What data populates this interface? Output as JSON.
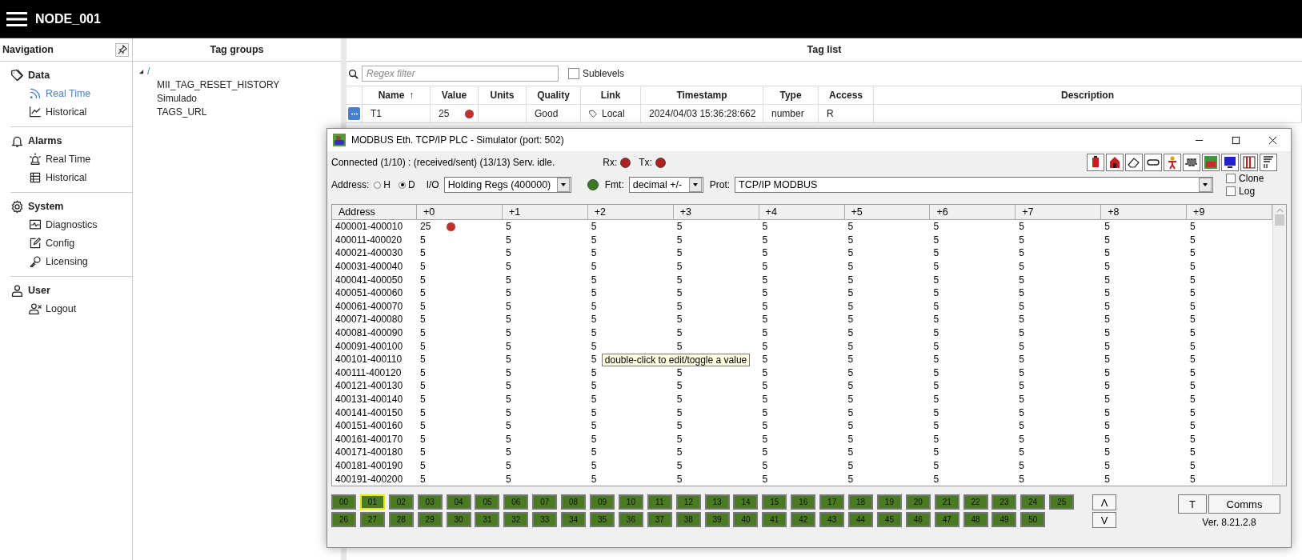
{
  "header": {
    "title": "NODE_001"
  },
  "navigation": {
    "title": "Navigation",
    "sections": [
      {
        "label": "Data",
        "items": [
          {
            "label": "Real Time",
            "selected": true
          },
          {
            "label": "Historical",
            "selected": false
          }
        ]
      },
      {
        "label": "Alarms",
        "items": [
          {
            "label": "Real Time",
            "selected": false
          },
          {
            "label": "Historical",
            "selected": false
          }
        ]
      },
      {
        "label": "System",
        "items": [
          {
            "label": "Diagnostics",
            "selected": false
          },
          {
            "label": "Config",
            "selected": false
          },
          {
            "label": "Licensing",
            "selected": false
          }
        ]
      },
      {
        "label": "User",
        "items": [
          {
            "label": "Logout",
            "selected": false
          }
        ]
      }
    ]
  },
  "tag_groups": {
    "title": "Tag groups",
    "tree": [
      {
        "label": "/",
        "expanded": true,
        "children": [
          {
            "label": "MII_TAG_RESET_HISTORY"
          },
          {
            "label": "Simulado"
          },
          {
            "label": "TAGS_URL"
          }
        ]
      }
    ]
  },
  "tag_list": {
    "title": "Tag list",
    "filter": {
      "placeholder": "Regex filter"
    },
    "sublevels": {
      "label": "Sublevels",
      "checked": false
    },
    "columns": [
      {
        "label": "Name",
        "sort": "↑"
      },
      {
        "label": "Value"
      },
      {
        "label": "Units"
      },
      {
        "label": "Quality"
      },
      {
        "label": "Link"
      },
      {
        "label": "Timestamp"
      },
      {
        "label": "Type"
      },
      {
        "label": "Access"
      },
      {
        "label": "Description"
      }
    ],
    "rows": [
      {
        "name": "T1",
        "value": "25",
        "marked": true,
        "quality": "Good",
        "link": "Local",
        "timestamp": "2024/04/03 15:36:28:662",
        "type": "number",
        "access": "R"
      }
    ]
  },
  "simulator": {
    "title": "MODBUS Eth. TCP/IP PLC - Simulator (port: 502)",
    "status": "Connected (1/10) : (received/sent) (13/13) Serv. idle.",
    "indicators": [
      {
        "label": "Rx:",
        "color": "#b02020"
      },
      {
        "label": "Tx:",
        "color": "#b02020"
      }
    ],
    "address": {
      "label": "Address:",
      "options": [
        {
          "label": "H",
          "selected": false
        },
        {
          "label": "D",
          "selected": true
        }
      ]
    },
    "io": {
      "label": "I/O",
      "value": "Holding Regs (400000)"
    },
    "fmt": {
      "label": "Fmt:",
      "value": "decimal +/-"
    },
    "prot": {
      "label": "Prot:",
      "value": "TCP/IP MODBUS"
    },
    "options": [
      {
        "label": "Clone",
        "checked": false
      },
      {
        "label": "Log",
        "checked": false
      }
    ],
    "grid": {
      "columns": [
        "Address",
        "+0",
        "+1",
        "+2",
        "+3",
        "+4",
        "+5",
        "+6",
        "+7",
        "+8",
        "+9"
      ],
      "rows": [
        {
          "address": "400001-400010",
          "marked": true,
          "values": [
            "25",
            "5",
            "5",
            "5",
            "5",
            "5",
            "5",
            "5",
            "5",
            "5"
          ]
        },
        {
          "address": "400011-400020",
          "marked": false,
          "values": [
            "5",
            "5",
            "5",
            "5",
            "5",
            "5",
            "5",
            "5",
            "5",
            "5"
          ]
        },
        {
          "address": "400021-400030",
          "marked": false,
          "values": [
            "5",
            "5",
            "5",
            "5",
            "5",
            "5",
            "5",
            "5",
            "5",
            "5"
          ]
        },
        {
          "address": "400031-400040",
          "marked": false,
          "values": [
            "5",
            "5",
            "5",
            "5",
            "5",
            "5",
            "5",
            "5",
            "5",
            "5"
          ]
        },
        {
          "address": "400041-400050",
          "marked": false,
          "values": [
            "5",
            "5",
            "5",
            "5",
            "5",
            "5",
            "5",
            "5",
            "5",
            "5"
          ]
        },
        {
          "address": "400051-400060",
          "marked": false,
          "values": [
            "5",
            "5",
            "5",
            "5",
            "5",
            "5",
            "5",
            "5",
            "5",
            "5"
          ]
        },
        {
          "address": "400061-400070",
          "marked": false,
          "values": [
            "5",
            "5",
            "5",
            "5",
            "5",
            "5",
            "5",
            "5",
            "5",
            "5"
          ]
        },
        {
          "address": "400071-400080",
          "marked": false,
          "values": [
            "5",
            "5",
            "5",
            "5",
            "5",
            "5",
            "5",
            "5",
            "5",
            "5"
          ]
        },
        {
          "address": "400081-400090",
          "marked": false,
          "values": [
            "5",
            "5",
            "5",
            "5",
            "5",
            "5",
            "5",
            "5",
            "5",
            "5"
          ]
        },
        {
          "address": "400091-400100",
          "marked": false,
          "values": [
            "5",
            "5",
            "5",
            "5",
            "5",
            "5",
            "5",
            "5",
            "5",
            "5"
          ]
        },
        {
          "address": "400101-400110",
          "marked": false,
          "tooltip": "double-click to edit/toggle a value",
          "values": [
            "5",
            "5",
            "5",
            "5",
            "5",
            "5",
            "5",
            "5",
            "5"
          ]
        },
        {
          "address": "400111-400120",
          "marked": false,
          "values": [
            "5",
            "5",
            "5",
            "5",
            "5",
            "5",
            "5",
            "5",
            "5",
            "5"
          ]
        },
        {
          "address": "400121-400130",
          "marked": false,
          "values": [
            "5",
            "5",
            "5",
            "5",
            "5",
            "5",
            "5",
            "5",
            "5",
            "5"
          ]
        },
        {
          "address": "400131-400140",
          "marked": false,
          "values": [
            "5",
            "5",
            "5",
            "5",
            "5",
            "5",
            "5",
            "5",
            "5",
            "5"
          ]
        },
        {
          "address": "400141-400150",
          "marked": false,
          "values": [
            "5",
            "5",
            "5",
            "5",
            "5",
            "5",
            "5",
            "5",
            "5",
            "5"
          ]
        },
        {
          "address": "400151-400160",
          "marked": false,
          "values": [
            "5",
            "5",
            "5",
            "5",
            "5",
            "5",
            "5",
            "5",
            "5",
            "5"
          ]
        },
        {
          "address": "400161-400170",
          "marked": false,
          "values": [
            "5",
            "5",
            "5",
            "5",
            "5",
            "5",
            "5",
            "5",
            "5",
            "5"
          ]
        },
        {
          "address": "400171-400180",
          "marked": false,
          "values": [
            "5",
            "5",
            "5",
            "5",
            "5",
            "5",
            "5",
            "5",
            "5",
            "5"
          ]
        },
        {
          "address": "400181-400190",
          "marked": false,
          "values": [
            "5",
            "5",
            "5",
            "5",
            "5",
            "5",
            "5",
            "5",
            "5",
            "5"
          ]
        },
        {
          "address": "400191-400200",
          "marked": false,
          "values": [
            "5",
            "5",
            "5",
            "5",
            "5",
            "5",
            "5",
            "5",
            "5",
            "5"
          ]
        }
      ]
    },
    "pages": [
      {
        "label": "00",
        "selected": false
      },
      {
        "label": "01",
        "selected": true
      },
      {
        "label": "02",
        "selected": false
      },
      {
        "label": "03",
        "selected": false
      },
      {
        "label": "04",
        "selected": false
      },
      {
        "label": "05",
        "selected": false
      },
      {
        "label": "06",
        "selected": false
      },
      {
        "label": "07",
        "selected": false
      },
      {
        "label": "08",
        "selected": false
      },
      {
        "label": "09",
        "selected": false
      },
      {
        "label": "10",
        "selected": false
      },
      {
        "label": "11",
        "selected": false
      },
      {
        "label": "12",
        "selected": false
      },
      {
        "label": "13",
        "selected": false
      },
      {
        "label": "14",
        "selected": false
      },
      {
        "label": "15",
        "selected": false
      },
      {
        "label": "16",
        "selected": false
      },
      {
        "label": "17",
        "selected": false
      },
      {
        "label": "18",
        "selected": false
      },
      {
        "label": "19",
        "selected": false
      },
      {
        "label": "20",
        "selected": false
      },
      {
        "label": "21",
        "selected": false
      },
      {
        "label": "22",
        "selected": false
      },
      {
        "label": "23",
        "selected": false
      },
      {
        "label": "24",
        "selected": false
      },
      {
        "label": "25",
        "selected": false
      },
      {
        "label": "26",
        "selected": false
      },
      {
        "label": "27",
        "selected": false
      },
      {
        "label": "28",
        "selected": false
      },
      {
        "label": "29",
        "selected": false
      },
      {
        "label": "30",
        "selected": false
      },
      {
        "label": "31",
        "selected": false
      },
      {
        "label": "32",
        "selected": false
      },
      {
        "label": "33",
        "selected": false
      },
      {
        "label": "34",
        "selected": false
      },
      {
        "label": "35",
        "selected": false
      },
      {
        "label": "36",
        "selected": false
      },
      {
        "label": "37",
        "selected": false
      },
      {
        "label": "38",
        "selected": false
      },
      {
        "label": "39",
        "selected": false
      },
      {
        "label": "40",
        "selected": false
      },
      {
        "label": "41",
        "selected": false
      },
      {
        "label": "42",
        "selected": false
      },
      {
        "label": "43",
        "selected": false
      },
      {
        "label": "44",
        "selected": false
      },
      {
        "label": "45",
        "selected": false
      },
      {
        "label": "46",
        "selected": false
      },
      {
        "label": "47",
        "selected": false
      },
      {
        "label": "48",
        "selected": false
      },
      {
        "label": "49",
        "selected": false
      },
      {
        "label": "50",
        "selected": false
      }
    ],
    "scroll_buttons": [
      "Λ",
      "V"
    ],
    "buttons": [
      "T",
      "Comms"
    ],
    "version": "Ver. 8.21.2.8"
  }
}
